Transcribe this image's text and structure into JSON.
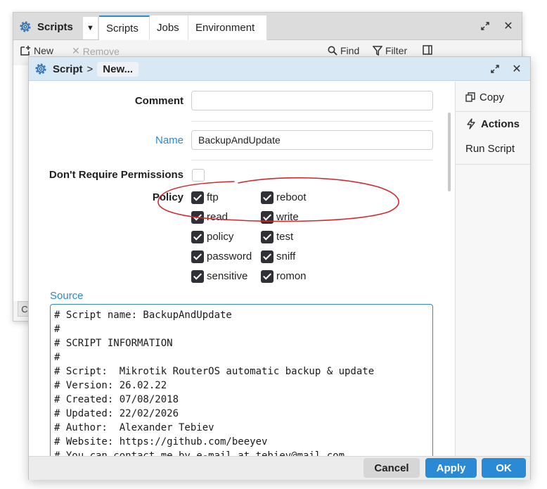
{
  "background_window": {
    "title": "Scripts",
    "tabs": [
      {
        "label": "Scripts",
        "active": true
      },
      {
        "label": "Jobs",
        "active": false
      },
      {
        "label": "Environment",
        "active": false
      }
    ],
    "toolbar": {
      "new_label": "New",
      "remove_label": "Remove",
      "find_label": "Find",
      "filter_label": "Filter"
    },
    "bottom_chip": "C"
  },
  "dialog": {
    "breadcrumb_root": "Script",
    "breadcrumb_separator": ">",
    "breadcrumb_current": "New...",
    "fields": {
      "comment_label": "Comment",
      "comment_value": "",
      "name_label": "Name",
      "name_value": "BackupAndUpdate",
      "permissions_label": "Don't Require Permissions",
      "permissions_checked": false,
      "policy_label": "Policy",
      "source_label": "Source"
    },
    "policies": [
      {
        "label": "ftp",
        "checked": true
      },
      {
        "label": "reboot",
        "checked": true
      },
      {
        "label": "read",
        "checked": true
      },
      {
        "label": "write",
        "checked": true
      },
      {
        "label": "policy",
        "checked": true
      },
      {
        "label": "test",
        "checked": true
      },
      {
        "label": "password",
        "checked": true
      },
      {
        "label": "sniff",
        "checked": true
      },
      {
        "label": "sensitive",
        "checked": true
      },
      {
        "label": "romon",
        "checked": true
      }
    ],
    "source_lines": [
      "# Script name: BackupAndUpdate",
      "#",
      "# SCRIPT INFORMATION",
      "#",
      "# Script:  Mikrotik RouterOS automatic backup & update",
      "# Version: 26.02.22",
      "# Created: 07/08/2018",
      "# Updated: 22/02/2026",
      "# Author:  Alexander Tebiev",
      "# Website: https://github.com/beeyev",
      "# You can contact me by e-mail at tebiev@mail.com"
    ],
    "side_panel": {
      "copy_label": "Copy",
      "actions_label": "Actions",
      "run_label": "Run Script"
    },
    "footer": {
      "cancel_label": "Cancel",
      "apply_label": "Apply",
      "ok_label": "OK"
    }
  },
  "colors": {
    "accent": "#2b8ad6",
    "annotation": "#d9262b",
    "dialog_titlebar": "#d8e8f5",
    "checkbox_on": "#2f3136"
  }
}
